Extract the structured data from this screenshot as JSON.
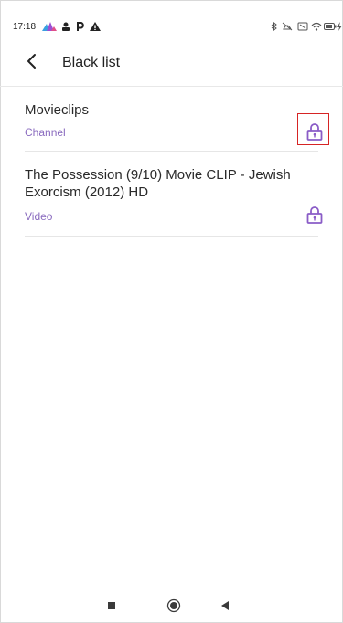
{
  "status_bar": {
    "time": "17:18",
    "icons": [
      "app-icon",
      "person-icon",
      "p-icon",
      "warning-icon",
      "bluetooth-icon",
      "mute-icon",
      "sim-icon",
      "wifi-icon",
      "battery-icon",
      "charging-icon"
    ],
    "battery_level": "70"
  },
  "header": {
    "back_icon": "chevron-left-icon",
    "title": "Black list"
  },
  "items": [
    {
      "title": "Movieclips",
      "type": "Channel",
      "icon": "lock-icon",
      "highlighted": true
    },
    {
      "title": "The Possession (9/10) Movie CLIP - Jewish Exorcism (2012) HD",
      "type": "Video",
      "icon": "lock-icon",
      "highlighted": false
    }
  ],
  "colors": {
    "accent": "#8a5cc7",
    "type_label": "#8a6bbf",
    "highlight": "#d62424"
  },
  "nav_bar": {
    "icons": [
      "recents-square-icon",
      "home-circle-icon",
      "back-triangle-icon"
    ]
  }
}
